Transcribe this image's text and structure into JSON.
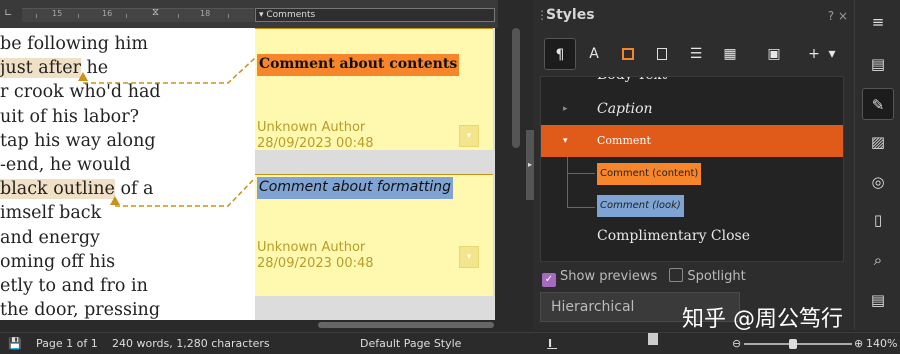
{
  "ruler": {
    "numbers": [
      "15",
      "16",
      "17",
      "18"
    ],
    "comment_dropdown": "Comments"
  },
  "document": {
    "lines": [
      "be following him",
      "just after he",
      "r crook who'd had",
      "uit of his labor?",
      "tap his way along",
      "-end, he would",
      "black outline of a",
      "imself back",
      "and energy",
      "oming off his",
      "etly to and fro in",
      "the door, pressing"
    ],
    "highlight_1": "just after",
    "highlight_2": "black outline"
  },
  "comments": [
    {
      "text": "Comment about contents",
      "author": "Unknown Author",
      "datetime": "28/09/2023 00:48",
      "color": "#f7862a"
    },
    {
      "text": "Comment about formatting",
      "author": "Unknown Author",
      "datetime": "28/09/2023 00:48",
      "color": "#7fa4d4"
    }
  ],
  "styles_panel": {
    "title": "Styles",
    "help": "?",
    "close": "×",
    "toolbar": [
      "paragraph-styles",
      "character-styles",
      "frame-styles",
      "page-styles",
      "list-styles",
      "table-styles",
      "fill-format",
      "new-style",
      "style-actions"
    ],
    "items": [
      {
        "label": "Body Text",
        "expander": "▸"
      },
      {
        "label": "Caption",
        "expander": "▸"
      },
      {
        "label": "Comment",
        "expander": "▾"
      },
      {
        "label": "Comment (content)",
        "color": "#f7862a"
      },
      {
        "label": "Comment (look)",
        "color": "#7fa4d4"
      },
      {
        "label": "Complimentary Close"
      }
    ],
    "show_previews_label": "Show previews",
    "show_previews_checked": true,
    "spotlight_label": "Spotlight",
    "spotlight_checked": false,
    "filter_value": "Hierarchical"
  },
  "sidebar_icons": [
    "menu-icon",
    "properties-icon",
    "styles-icon",
    "gallery-icon",
    "navigator-icon",
    "page-icon",
    "style-inspector-icon",
    "manage-changes-icon"
  ],
  "status": {
    "page": "Page 1 of 1",
    "words": "240 words, 1,280 characters",
    "page_style": "Default Page Style",
    "zoom": "140%"
  },
  "watermark": "知乎 @周公笃行",
  "colors": {
    "selected_style": "#e05a1a",
    "anchor_line": "#c8921a",
    "comment_bg": "#fff9b0",
    "checkbox_checked": "#a66bbf"
  }
}
